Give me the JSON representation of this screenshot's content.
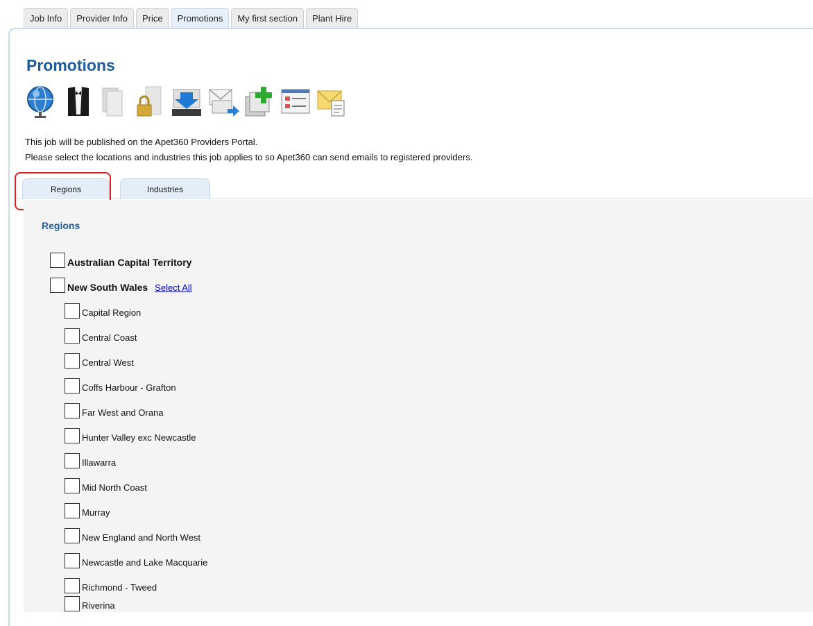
{
  "top_tabs": [
    {
      "label": "Job Info"
    },
    {
      "label": "Provider Info"
    },
    {
      "label": "Price"
    },
    {
      "label": "Promotions"
    },
    {
      "label": "My first section"
    },
    {
      "label": "Plant Hire"
    }
  ],
  "active_tab": "Promotions",
  "page_title": "Promotions",
  "toolbar_icons": [
    "globe-icon",
    "tuxedo-icon",
    "documents-icon",
    "lock-document-icon",
    "download-icon",
    "send-mail-icon",
    "add-document-icon",
    "form-list-icon",
    "envelope-document-icon"
  ],
  "info_lines": [
    "This job will be published on the Apet360 Providers Portal.",
    "Please select the locations and industries this job applies to so Apet360 can send emails to registered providers."
  ],
  "sub_tabs": {
    "regions": "Regions",
    "industries": "Industries"
  },
  "section_title": "Regions",
  "regions": {
    "act": "Australian Capital Territory",
    "nsw": "New South Wales",
    "select_all": "Select All",
    "nsw_items": [
      "Capital Region",
      "Central Coast",
      "Central West",
      "Coffs Harbour - Grafton",
      "Far West and Orana",
      "Hunter Valley exc Newcastle",
      "Illawarra",
      "Mid North Coast",
      "Murray",
      "New England and North West",
      "Newcastle and Lake Macquarie",
      "Richmond - Tweed",
      "Riverina"
    ]
  },
  "colors": {
    "title_blue": "#1f5e9e",
    "highlight_red": "#e02020",
    "link_blue": "#0000cc"
  }
}
